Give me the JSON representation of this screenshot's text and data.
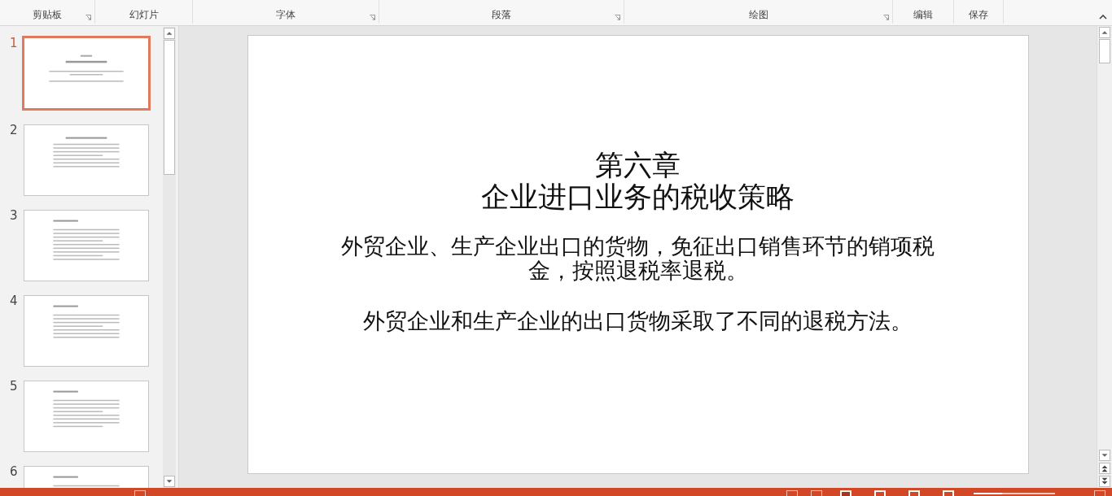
{
  "ribbon": {
    "groups": [
      {
        "label": "剪贴板",
        "launcher": true
      },
      {
        "label": "幻灯片",
        "launcher": false
      },
      {
        "label": "字体",
        "launcher": true
      },
      {
        "label": "段落",
        "launcher": true
      },
      {
        "label": "绘图",
        "launcher": true
      },
      {
        "label": "编辑",
        "launcher": false
      },
      {
        "label": "保存",
        "launcher": false
      }
    ]
  },
  "thumbnails": [
    {
      "number": "1",
      "selected": true
    },
    {
      "number": "2",
      "selected": false
    },
    {
      "number": "3",
      "selected": false
    },
    {
      "number": "4",
      "selected": false
    },
    {
      "number": "5",
      "selected": false
    },
    {
      "number": "6",
      "selected": false
    }
  ],
  "slide": {
    "title": [
      "第六章",
      "企业进口业务的税收策略"
    ],
    "paragraphs": [
      "外贸企业、生产企业出口的货物，免征出口销售环节的销项税金，按照退税率退税。",
      "外贸企业和生产企业的出口货物采取了不同的退税方法。"
    ]
  },
  "status_bar": {
    "zoom_slider": {
      "level": 0.35
    }
  }
}
